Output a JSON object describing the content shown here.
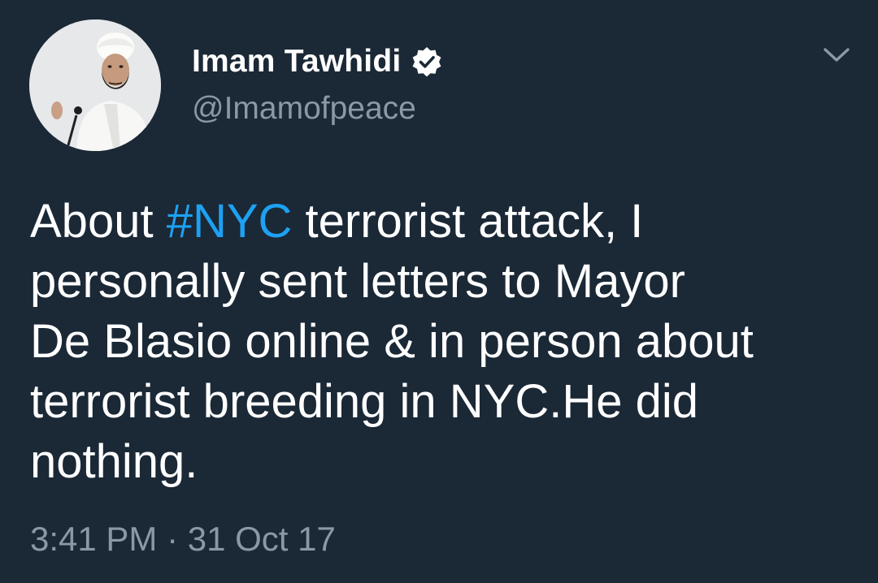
{
  "colors": {
    "background": "#1b2836",
    "text_primary": "#ffffff",
    "text_secondary": "#8b98a5",
    "hashtag": "#1da1f2"
  },
  "author": {
    "display_name": "Imam Tawhidi",
    "handle": "@Imamofpeace",
    "verified": true,
    "avatar_icon": "profile-photo"
  },
  "tweet": {
    "lines": [
      {
        "before": "About ",
        "hashtag": "#NYC",
        "after": " terrorist attack, I"
      },
      {
        "text": "personally sent letters to Mayor"
      },
      {
        "text": "De Blasio online & in person about"
      },
      {
        "text": "terrorist breeding in NYC.He did"
      },
      {
        "text": "nothing."
      }
    ],
    "timestamp": "3:41 PM · 31 Oct 17"
  },
  "menu": {
    "icon": "chevron-down-icon"
  }
}
